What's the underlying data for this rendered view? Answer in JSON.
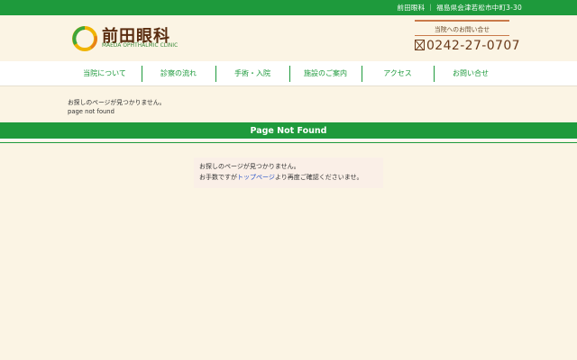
{
  "topbar": {
    "text": "前田眼科 ｜ 福島県会津若松市中町3-30"
  },
  "logo": {
    "name_jp": "前田眼科",
    "name_en": "MAEDA OPHTHALMIC CLINIC"
  },
  "contact": {
    "label": "当院へのお問い合せ",
    "phone": "0242-27-0707"
  },
  "nav": {
    "items": [
      {
        "label": "当院について"
      },
      {
        "label": "診察の流れ"
      },
      {
        "label": "手術・入院"
      },
      {
        "label": "施設のご案内"
      },
      {
        "label": "アクセス"
      },
      {
        "label": "お問い合せ"
      }
    ]
  },
  "notice": {
    "jp": "お探しのページが見つかりません。",
    "en": "page not found"
  },
  "banner": {
    "title": "Page Not Found"
  },
  "content": {
    "line1": "お探しのページが見つかりません。",
    "line2_before": "お手数ですが",
    "line2_link": "トップページ",
    "line2_after": "より再度ご確認くださいませ。"
  },
  "colors": {
    "brand_green": "#1e9a3c",
    "background": "#fbf4e4",
    "link_blue": "#2a55c8",
    "brown": "#6b3a1a"
  }
}
